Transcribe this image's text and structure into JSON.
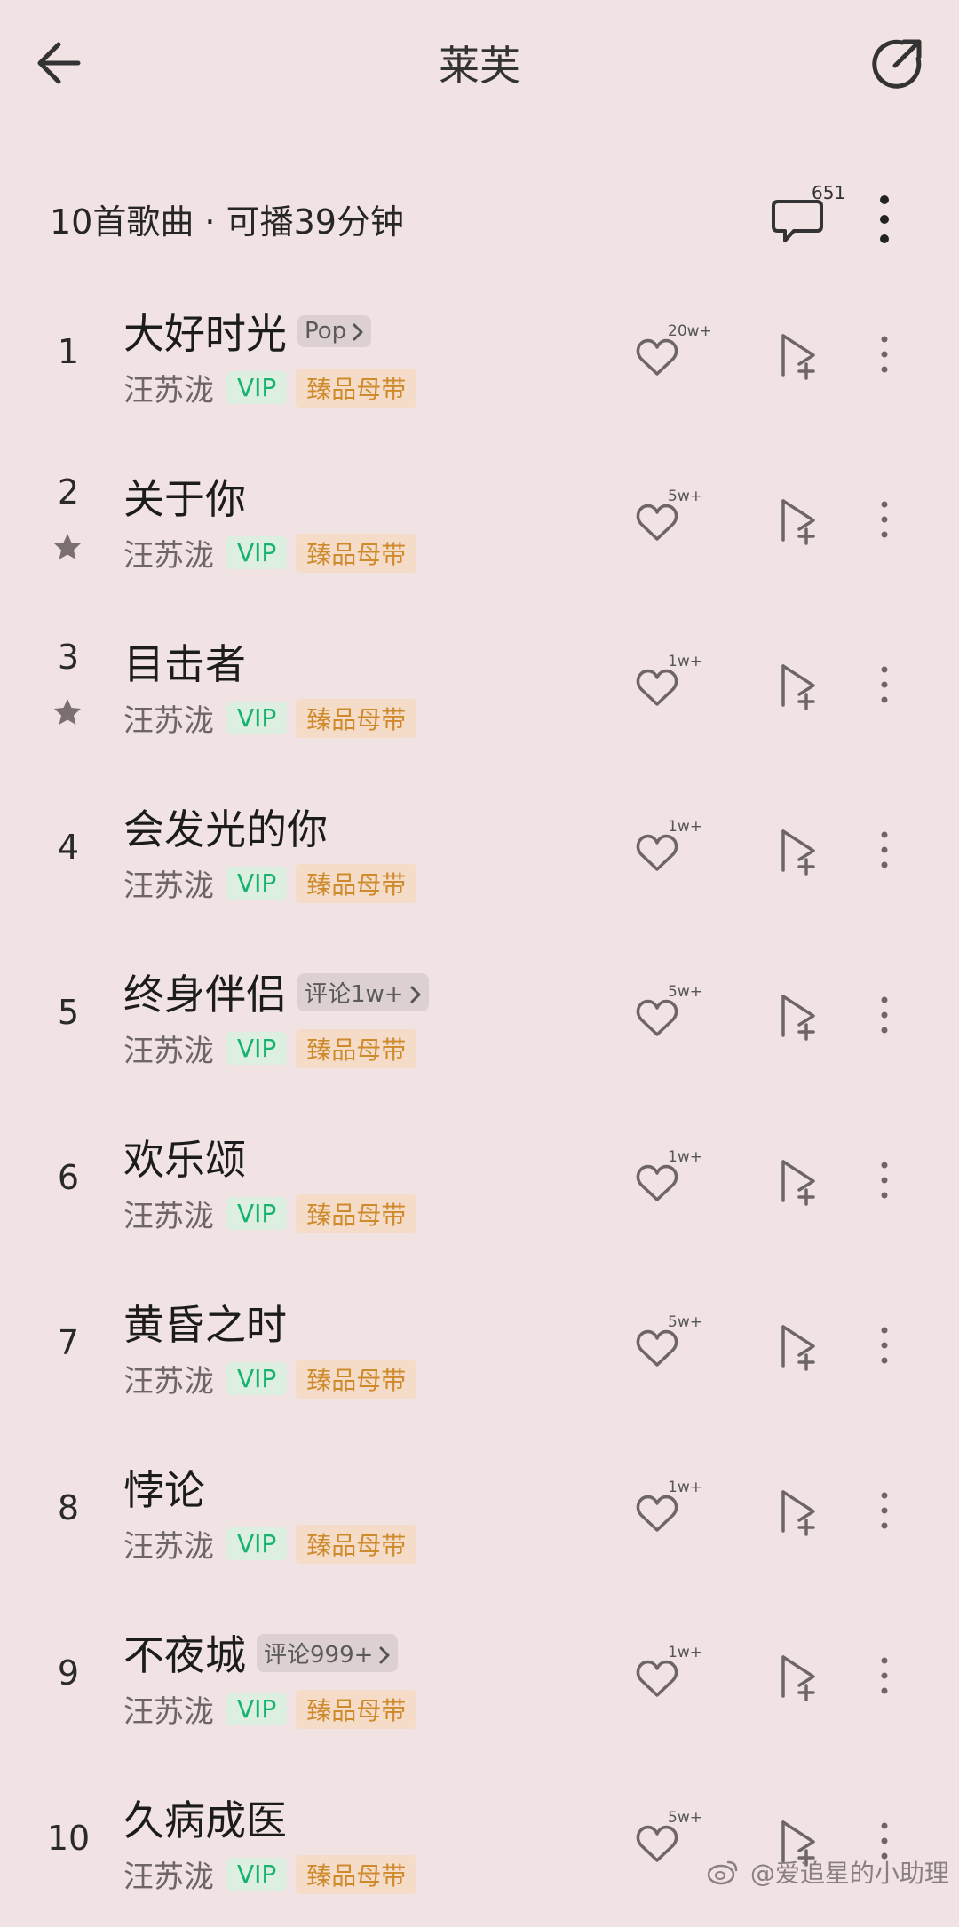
{
  "header": {
    "title": "莱芙"
  },
  "summary": {
    "text": "10首歌曲 · 可播39分钟",
    "comment_count": "651"
  },
  "songs": [
    {
      "index": "1",
      "title": "大好时光",
      "tag": "Pop",
      "artist": "汪苏泷",
      "vip": "VIP",
      "quality": "臻品母带",
      "likes": "20w+",
      "starred": false
    },
    {
      "index": "2",
      "title": "关于你",
      "tag": null,
      "artist": "汪苏泷",
      "vip": "VIP",
      "quality": "臻品母带",
      "likes": "5w+",
      "starred": true
    },
    {
      "index": "3",
      "title": "目击者",
      "tag": null,
      "artist": "汪苏泷",
      "vip": "VIP",
      "quality": "臻品母带",
      "likes": "1w+",
      "starred": true
    },
    {
      "index": "4",
      "title": "会发光的你",
      "tag": null,
      "artist": "汪苏泷",
      "vip": "VIP",
      "quality": "臻品母带",
      "likes": "1w+",
      "starred": false
    },
    {
      "index": "5",
      "title": "终身伴侣",
      "tag": "评论1w+",
      "artist": "汪苏泷",
      "vip": "VIP",
      "quality": "臻品母带",
      "likes": "5w+",
      "starred": false
    },
    {
      "index": "6",
      "title": "欢乐颂",
      "tag": null,
      "artist": "汪苏泷",
      "vip": "VIP",
      "quality": "臻品母带",
      "likes": "1w+",
      "starred": false
    },
    {
      "index": "7",
      "title": "黄昏之时",
      "tag": null,
      "artist": "汪苏泷",
      "vip": "VIP",
      "quality": "臻品母带",
      "likes": "5w+",
      "starred": false
    },
    {
      "index": "8",
      "title": "悖论",
      "tag": null,
      "artist": "汪苏泷",
      "vip": "VIP",
      "quality": "臻品母带",
      "likes": "1w+",
      "starred": false
    },
    {
      "index": "9",
      "title": "不夜城",
      "tag": "评论999+",
      "artist": "汪苏泷",
      "vip": "VIP",
      "quality": "臻品母带",
      "likes": "1w+",
      "starred": false
    },
    {
      "index": "10",
      "title": "久病成医",
      "tag": null,
      "artist": "汪苏泷",
      "vip": "VIP",
      "quality": "臻品母带",
      "likes": "5w+",
      "starred": false
    }
  ],
  "watermark": {
    "text": "@爱追星的小助理"
  },
  "icons": {
    "back": "arrow-left-icon",
    "share": "share-icon",
    "comments": "comment-bubble-icon",
    "more": "more-vertical-icon",
    "like": "heart-icon",
    "add": "add-to-playlist-icon",
    "star": "star-icon",
    "weibo": "weibo-logo"
  },
  "colors": {
    "background": "#f1e3e3",
    "vip_text": "#16b36c",
    "vip_bg": "#dcefe1",
    "quality_text": "#cf8a2c",
    "quality_bg": "#f4dcc8"
  }
}
